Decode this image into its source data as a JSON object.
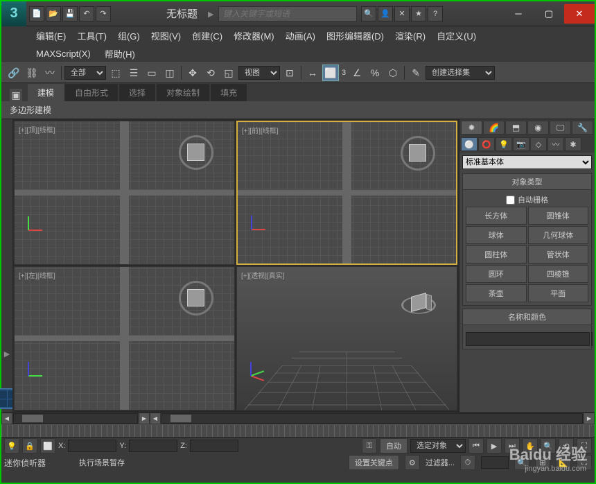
{
  "app_icon": "3",
  "title": "无标题",
  "search_placeholder": "键入关键字或短语",
  "menus": [
    "编辑(E)",
    "工具(T)",
    "组(G)",
    "视图(V)",
    "创建(C)",
    "修改器(M)",
    "动画(A)",
    "图形编辑器(D)",
    "渲染(R)",
    "自定义(U)"
  ],
  "menus2": [
    "MAXScript(X)",
    "帮助(H)"
  ],
  "toolbar": {
    "filter_combo": "全部",
    "ref_combo": "视图",
    "named_set": "创建选择集",
    "angle": "3"
  },
  "ribbon": {
    "tabs": [
      "建模",
      "自由形式",
      "选择",
      "对象绘制",
      "填充"
    ],
    "sub": "多边形建模"
  },
  "viewports": {
    "tl": "[+][顶][线框]",
    "tr": "[+][前][线框]",
    "bl": "[+][左][线框]",
    "br": "[+][透视][真实]"
  },
  "command_panel": {
    "category": "标准基本体",
    "rollout1_title": "对象类型",
    "autogrid": "自动栅格",
    "buttons": [
      "长方体",
      "圆锥体",
      "球体",
      "几何球体",
      "圆柱体",
      "管状体",
      "圆环",
      "四棱锥",
      "茶壶",
      "平面"
    ],
    "rollout2_title": "名称和颜色"
  },
  "status": {
    "x": "X:",
    "y": "Y:",
    "z": "Z:",
    "auto_key": "自动",
    "set_key": "设置关键点",
    "sel_filter": "选定对象",
    "filters": "过滤器...",
    "mini_listener": "迷你侦听器",
    "prompt": "执行场景暂存"
  },
  "watermark": {
    "main": "Baidu 经验",
    "sub": "jingyan.baidu.com"
  }
}
